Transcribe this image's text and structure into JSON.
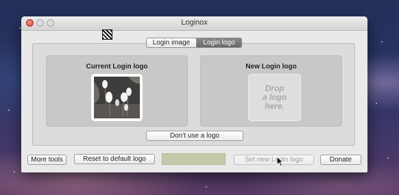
{
  "window": {
    "title": "Loginox"
  },
  "tabs": [
    {
      "label": "Login image",
      "selected": false
    },
    {
      "label": "Login logo",
      "selected": true
    }
  ],
  "current_logo": {
    "title": "Current Login logo"
  },
  "new_logo": {
    "title": "New Login logo",
    "drop_hint": "Drop\na logo\nhere."
  },
  "buttons": {
    "dont_use": "Don't use a logo",
    "more_tools": "More tools",
    "reset": "Reset to default logo",
    "set_new": "Set new Login logo",
    "set_new_enabled": false,
    "donate": "Donate"
  },
  "status_field": {
    "text": ""
  },
  "icons": {
    "app": "striped-app-icon",
    "close": "close-button-icon",
    "minimize": "minimize-button-icon",
    "zoom": "zoom-button-icon",
    "cursor": "arrow-cursor-icon"
  },
  "colors": {
    "window_bg": "#e9e9e9",
    "selected_tab": "#7a7a7a",
    "status_field": "#c4c9a9",
    "close_red": "#d6392c"
  }
}
